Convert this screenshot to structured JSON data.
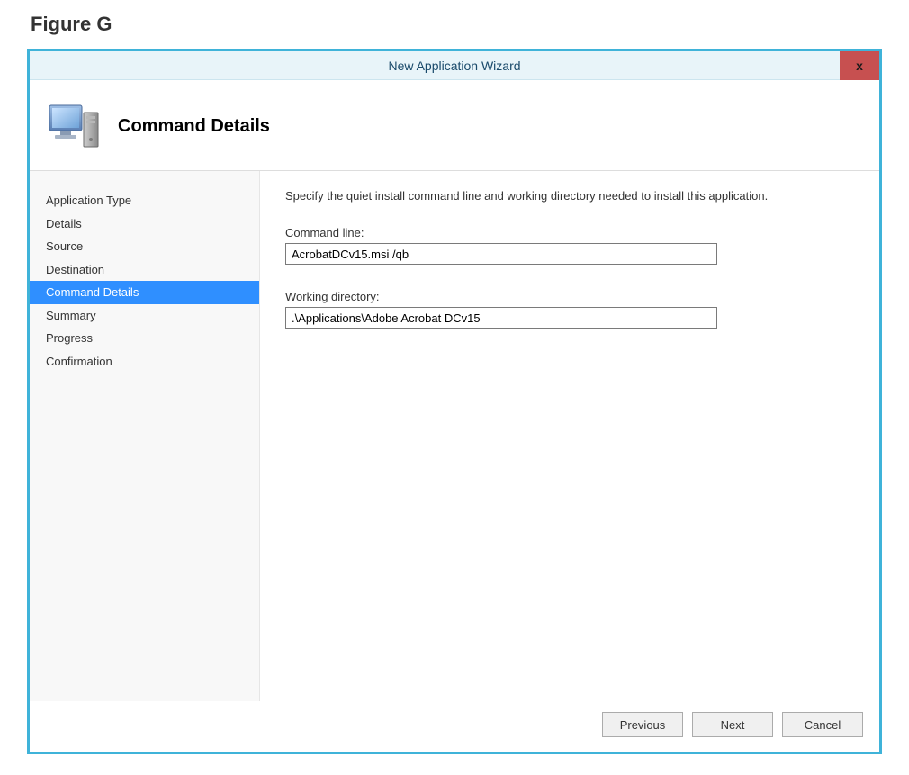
{
  "figure_label": "Figure G",
  "window": {
    "title": "New Application Wizard",
    "close_symbol": "x"
  },
  "header": {
    "title": "Command Details"
  },
  "sidebar": {
    "items": [
      {
        "label": "Application Type",
        "selected": false
      },
      {
        "label": "Details",
        "selected": false
      },
      {
        "label": "Source",
        "selected": false
      },
      {
        "label": "Destination",
        "selected": false
      },
      {
        "label": "Command Details",
        "selected": true
      },
      {
        "label": "Summary",
        "selected": false
      },
      {
        "label": "Progress",
        "selected": false
      },
      {
        "label": "Confirmation",
        "selected": false
      }
    ]
  },
  "content": {
    "instruction": "Specify the quiet install command line and working directory needed to install this application.",
    "command_line_label": "Command line:",
    "command_line_value": "AcrobatDCv15.msi /qb",
    "working_dir_label": "Working directory:",
    "working_dir_value": ".\\Applications\\Adobe Acrobat DCv15"
  },
  "buttons": {
    "previous": "Previous",
    "next": "Next",
    "cancel": "Cancel"
  }
}
